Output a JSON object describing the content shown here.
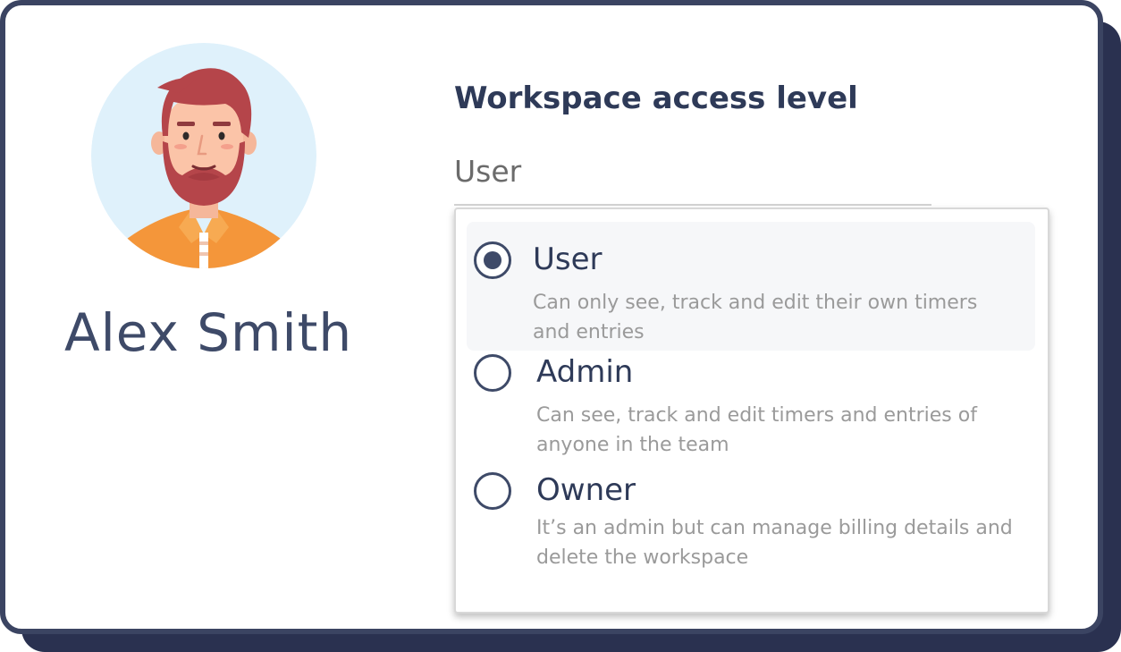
{
  "profile": {
    "name": "Alex Smith",
    "avatar_icon": "bearded-man-avatar"
  },
  "access": {
    "title": "Workspace access level",
    "selected_value": "User",
    "options": [
      {
        "label": "User",
        "description": "Can only see, track and edit their own timers\nand  entries",
        "selected": true
      },
      {
        "label": "Admin",
        "description": "Can see, track and edit timers and entries of\nanyone in the team",
        "selected": false
      },
      {
        "label": "Owner",
        "description": "It’s an admin but can manage billing details and\ndelete the workspace",
        "selected": false
      }
    ]
  },
  "colors": {
    "card_border": "#3b4462",
    "card_shadow": "#2a3150",
    "avatar_bg": "#dff1fb",
    "hair": "#b5454a",
    "shirt": "#f4963a",
    "text_primary": "#2e3a58",
    "text_muted": "#9a9a9a"
  }
}
